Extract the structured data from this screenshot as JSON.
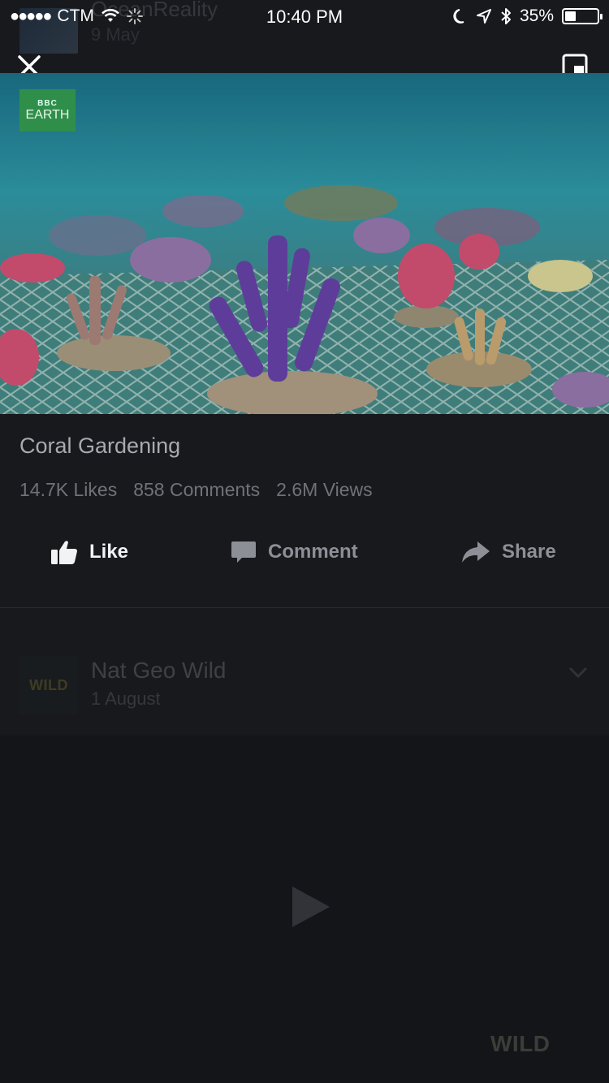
{
  "status_bar": {
    "carrier": "CTM",
    "time": "10:40 PM",
    "battery_percent": "35%",
    "battery_level": 0.35
  },
  "background_feed": {
    "post1": {
      "name": "OceanReality",
      "date": "9 May"
    },
    "post2": {
      "name": "Nat Geo Wild",
      "date": "1 August",
      "avatar_logo": "WILD",
      "watermark": "WILD"
    }
  },
  "video": {
    "channel_badge": {
      "line1": "BBC",
      "line2": "EARTH"
    }
  },
  "post": {
    "title": "Coral Gardening",
    "likes": "14.7K Likes",
    "comments": "858 Comments",
    "views": "2.6M Views"
  },
  "actions": {
    "like_label": "Like",
    "comment_label": "Comment",
    "share_label": "Share"
  },
  "icons": {
    "close": "close-icon",
    "pip": "picture-in-picture-icon",
    "like": "thumbs-up-icon",
    "comment": "speech-bubble-icon",
    "share": "share-arrow-icon",
    "play": "play-icon"
  },
  "colors": {
    "background": "#18191d",
    "like_active": "#f2f3f5",
    "muted_text": "#6f7278"
  }
}
